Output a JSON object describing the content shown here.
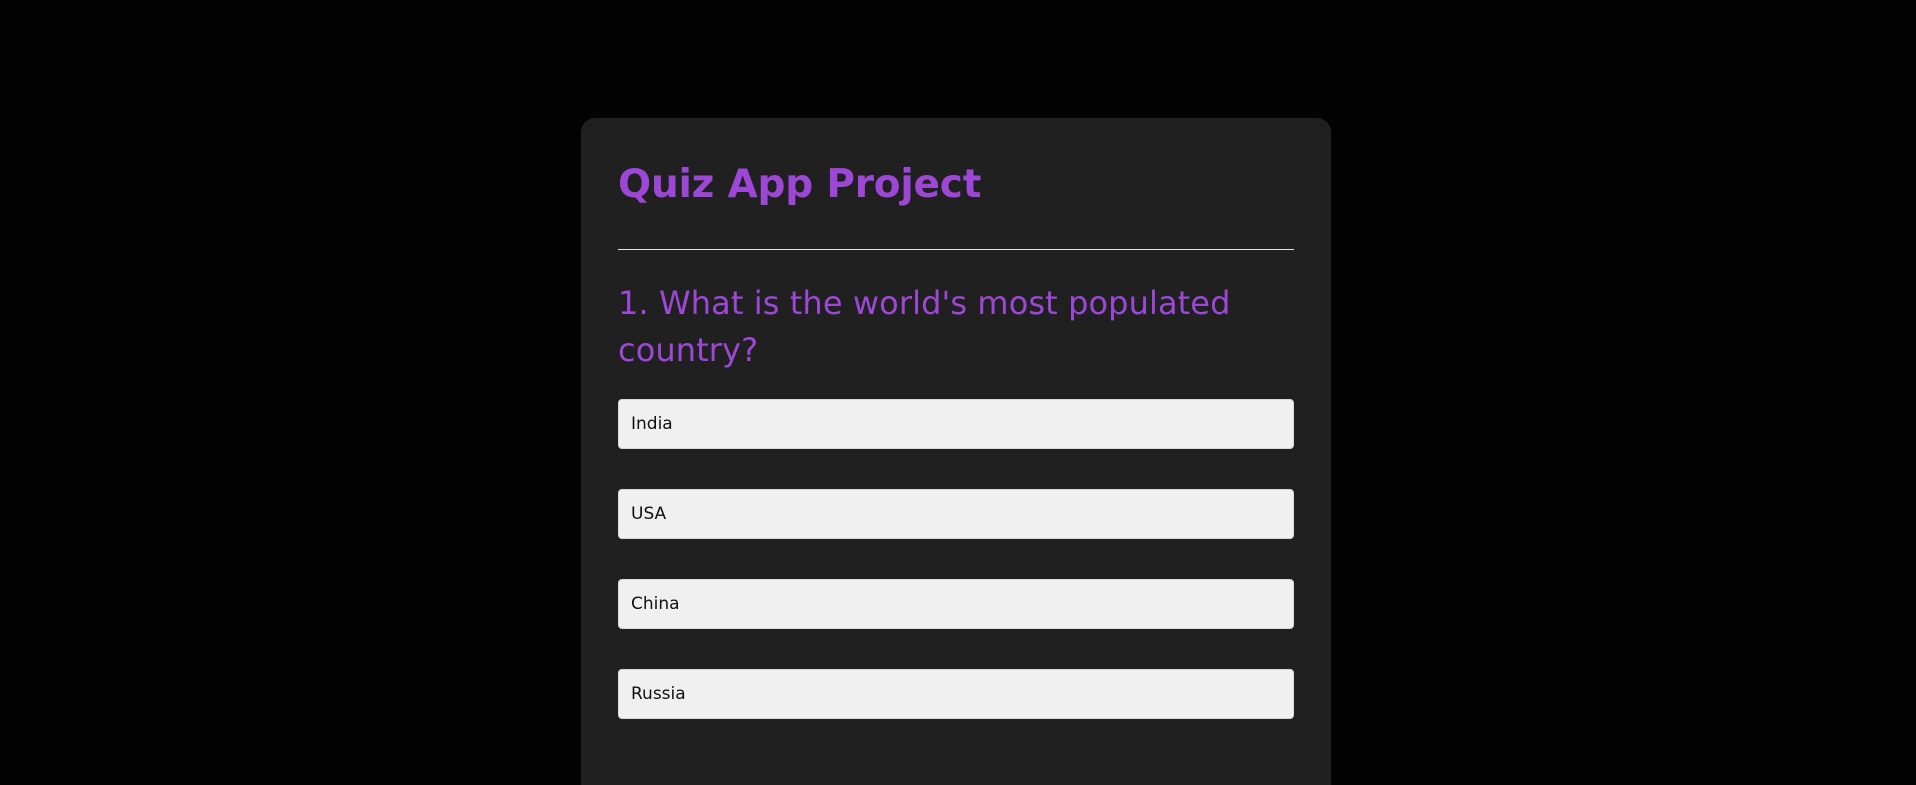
{
  "quiz": {
    "title": "Quiz App Project",
    "question": "1. What is the world's most populated country?",
    "answers": [
      {
        "label": "India"
      },
      {
        "label": "USA"
      },
      {
        "label": "China"
      },
      {
        "label": "Russia"
      }
    ]
  },
  "colors": {
    "background": "#030303",
    "card": "#202020",
    "accent": "#9d47d6",
    "answer_bg": "#f0f0f0"
  }
}
